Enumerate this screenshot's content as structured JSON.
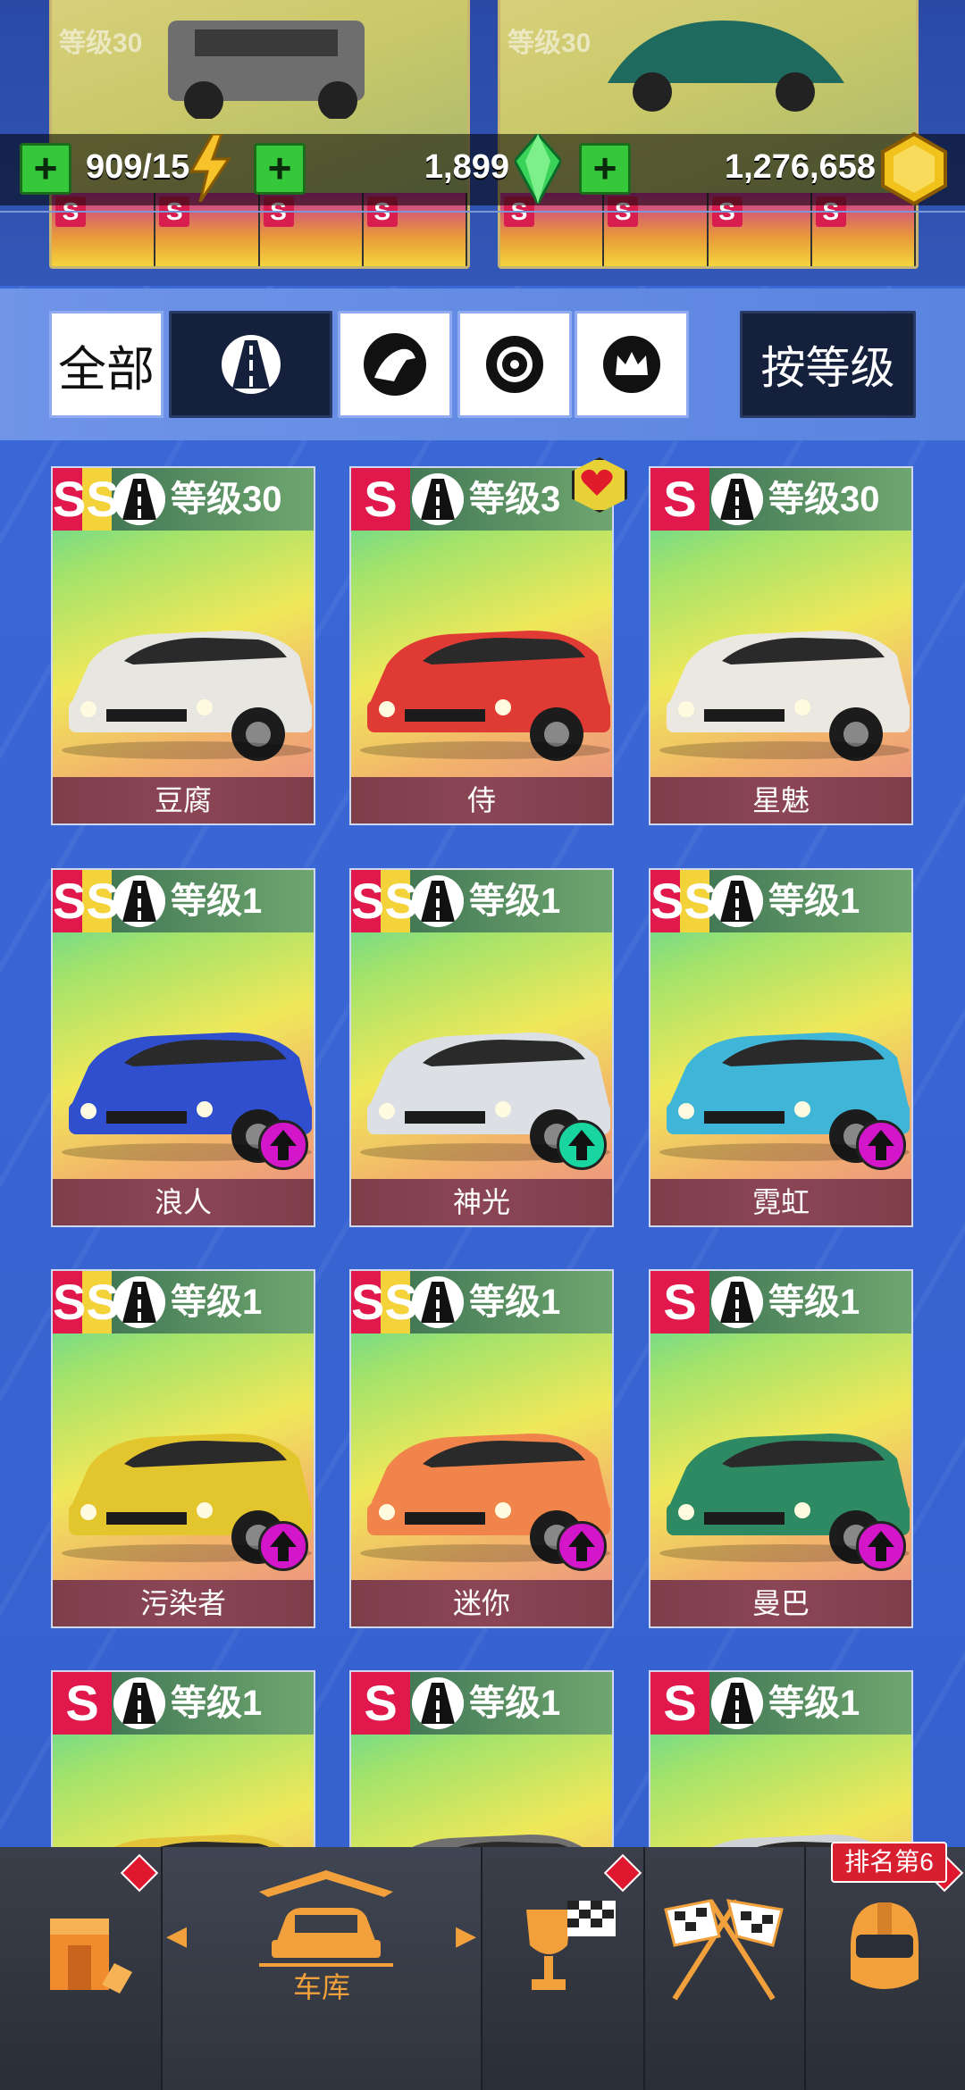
{
  "resources": {
    "energy": "909/15",
    "gems": "1,899",
    "coins": "1,276,658"
  },
  "top_cards": [
    {
      "level": "等级30",
      "parts": [
        "S",
        "S",
        "S",
        "S"
      ]
    },
    {
      "level": "等级30",
      "parts": [
        "S",
        "S",
        "S",
        "S"
      ]
    }
  ],
  "filters": {
    "all_label": "全部",
    "road_icon": "road-icon",
    "horse_icon": "horse-icon",
    "wheel_icon": "wheel-icon",
    "crown_icon": "crown-icon",
    "sort_label": "按等级"
  },
  "cars": [
    {
      "rank": "SS",
      "level": "等级30",
      "name": "豆腐",
      "color": "#e8e6e0"
    },
    {
      "rank": "S",
      "level": "等级3",
      "name": "侍",
      "color": "#e03a35",
      "favorite": true
    },
    {
      "rank": "S",
      "level": "等级30",
      "name": "星魅",
      "color": "#ebe8e2"
    },
    {
      "rank": "SS",
      "level": "等级1",
      "name": "浪人",
      "color": "#2f4fcf",
      "upgrade": "magenta"
    },
    {
      "rank": "SS",
      "level": "等级1",
      "name": "神光",
      "color": "#dcdfe3",
      "upgrade": "teal"
    },
    {
      "rank": "SS",
      "level": "等级1",
      "name": "霓虹",
      "color": "#3fb6d8",
      "upgrade": "magenta"
    },
    {
      "rank": "SS",
      "level": "等级1",
      "name": "污染者",
      "color": "#e3c62e",
      "upgrade": "magenta"
    },
    {
      "rank": "SS",
      "level": "等级1",
      "name": "迷你",
      "color": "#f0844a",
      "upgrade": "magenta"
    },
    {
      "rank": "S",
      "level": "等级1",
      "name": "曼巴",
      "color": "#2e8a63",
      "upgrade": "magenta"
    },
    {
      "rank": "S",
      "level": "等级1",
      "name": "",
      "color": "#e4c53a"
    },
    {
      "rank": "S",
      "level": "等级1",
      "name": "",
      "color": "#707070"
    },
    {
      "rank": "S",
      "level": "等级1",
      "name": "",
      "color": "#cfd2d6"
    }
  ],
  "nav": {
    "garage_label": "车库",
    "rank_badge": "排名第6",
    "items": [
      "shop-icon",
      "garage-car-icon",
      "trophy-icon",
      "race-flags-icon",
      "helmet-icon"
    ]
  }
}
